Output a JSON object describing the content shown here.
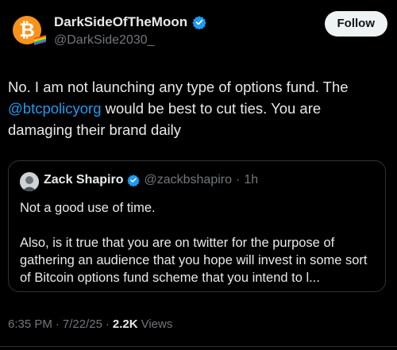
{
  "author": {
    "display_name": "DarkSideOfTheMoon",
    "handle": "@DarkSide2030_"
  },
  "follow_label": "Follow",
  "tweet": {
    "text_before": "No.  I am not launching any type of options fund.  The ",
    "mention": "@btcpolicyorg",
    "text_after": " would be best to cut ties.  You are damaging their brand daily"
  },
  "quoted": {
    "name": "Zack Shapiro",
    "handle": "@zackbshapiro",
    "separator": "·",
    "time": "1h",
    "text": "Not a good use of time.\n\nAlso, is it true that you are on twitter for the purpose of gathering an audience that you hope will invest in some sort of Bitcoin options fund scheme that you intend to l..."
  },
  "meta": {
    "time": "6:35 PM",
    "separator": "·",
    "date": "7/22/25",
    "separator2": "·",
    "views_count": "2.2K",
    "views_label": "Views"
  },
  "colors": {
    "background": "#000000",
    "text": "#e7e9ea",
    "muted": "#71767b",
    "link": "#1d9bf0",
    "verified": "#1d9bf0",
    "bitcoin": "#f7931a"
  }
}
